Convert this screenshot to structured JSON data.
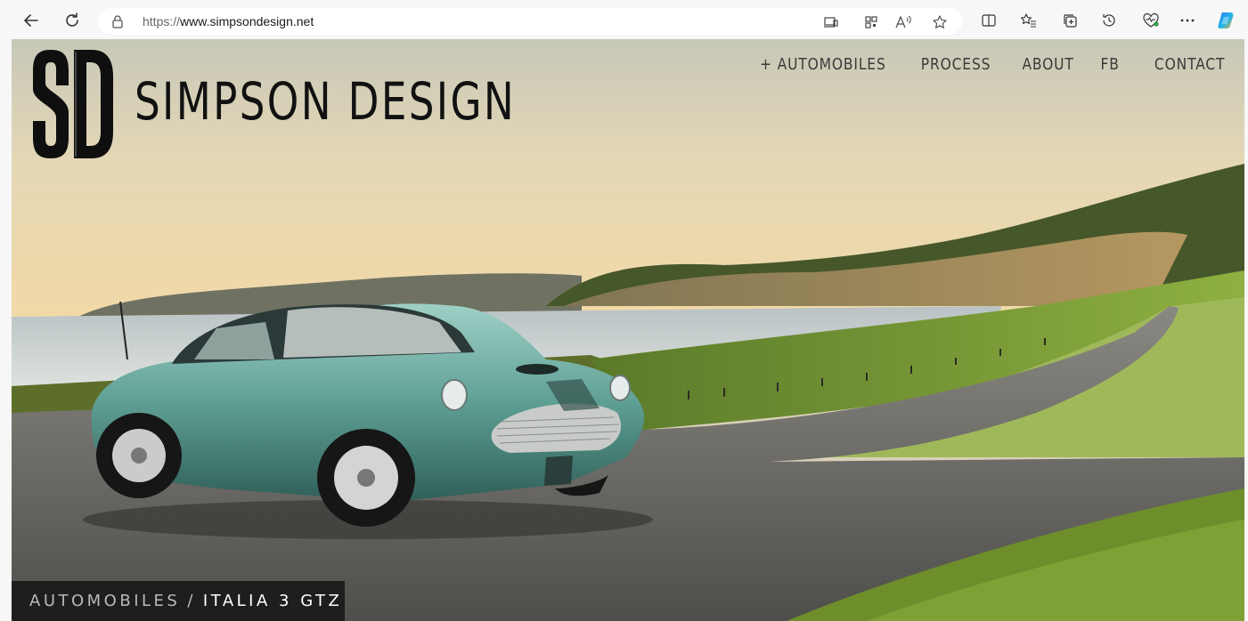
{
  "browser": {
    "url_protocol": "https://",
    "url_host": "www.simpsondesign.net",
    "icons": {
      "back": "arrow-left-icon",
      "refresh": "refresh-icon",
      "lock": "lock-icon",
      "app": "app-available-icon",
      "qr": "qr-code-icon",
      "read_aloud": "read-aloud-icon",
      "favorite": "star-icon",
      "split": "split-screen-icon",
      "favorites": "favorites-icon",
      "collections": "collections-icon",
      "history": "history-icon",
      "performance": "heart-pulse-icon",
      "more": "more-icon",
      "copilot": "copilot-icon"
    }
  },
  "site": {
    "logo_mark": "SD",
    "brand_name": "SIMPSON DESIGN",
    "nav": [
      "+ AUTOMOBILES",
      "PROCESS",
      "ABOUT",
      "FB",
      "CONTACT"
    ],
    "breadcrumb": {
      "section": "AUTOMOBILES",
      "separator": "/",
      "current": "ITALIA 3 GTZ"
    }
  },
  "colors": {
    "car": "#5e9f94",
    "sky_top": "#c9c9b8",
    "sky_bottom": "#efd9ad",
    "grass": "#7fa236",
    "road": "#6e6d69",
    "caption_bg": "#1e1e1e"
  }
}
